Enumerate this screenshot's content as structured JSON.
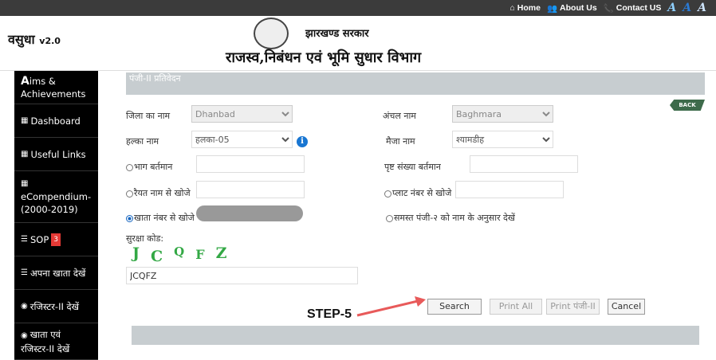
{
  "topnav": {
    "home": "Home",
    "about": "About Us",
    "contact": "Contact US",
    "font_a1": "A",
    "font_a2": "A",
    "font_a3": "A"
  },
  "header": {
    "brand": "वसुधा",
    "version": "v2.0",
    "gov": "झारखण्ड सरकार",
    "dept": "राजस्व,निबंधन एवं भूमि सुधार विभाग"
  },
  "sidebar": {
    "items": [
      {
        "label": "ims &\nAchievements",
        "lead": "A"
      },
      {
        "label": "Dashboard"
      },
      {
        "label": "Useful Links"
      },
      {
        "label": "eCompendium-\n(2000-2019)"
      },
      {
        "label": "SOP",
        "badge": "3"
      },
      {
        "label": "अपना खाता देखें"
      },
      {
        "label": "रजिस्टर-II देखें"
      },
      {
        "label": "खाता एवं\nरजिस्टर-II देखें"
      }
    ]
  },
  "form": {
    "title": "पंजी-II प्रतिवेदन",
    "back": "BACK",
    "district_label": "जिला का नाम",
    "district_value": "Dhanbad",
    "circle_label": "अंचल नाम",
    "circle_value": "Baghmara",
    "halka_label": "हल्का नाम",
    "halka_value": "हलका-05",
    "mauza_label": "मैजा नाम",
    "mauza_value": "श्यामडीह",
    "bhag_label": "भाग बर्तमान",
    "page_label": "पृष्ट संख्या बर्तमान",
    "raiyat_label": "रैयत नाम से खोजे",
    "plot_label": "प्लाट नंबर से खोजे",
    "khata_label": "खाता नंबर से खोजे",
    "all_label": "समस्त पंजी-२ को नाम के अनुसार देखें",
    "captcha_label": "सुरक्षा कोड:",
    "captcha_chars": [
      "J",
      "C",
      "Q",
      "F",
      "Z"
    ],
    "captcha_value": "JCQFZ",
    "search": "Search",
    "print_all": "Print All",
    "print_panji": "Print पंजी-II",
    "cancel": "Cancel"
  },
  "annotation": {
    "step": "STEP-5"
  }
}
